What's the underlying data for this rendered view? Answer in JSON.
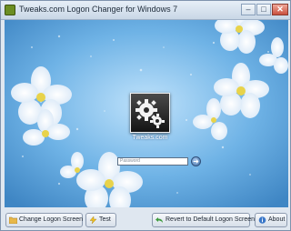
{
  "window": {
    "title": "Tweaks.com Logon Changer for Windows 7"
  },
  "login": {
    "username": "Tweaks.com",
    "password_placeholder": "Password"
  },
  "buttons": {
    "change": "Change Logon Screen",
    "test": "Test",
    "revert": "Revert to Default Logon Screen",
    "about": "About"
  },
  "icons": [
    "app-icon",
    "gear-icon",
    "folder-icon",
    "lightning-icon",
    "undo-icon",
    "info-icon",
    "arrow-right-icon"
  ],
  "colors": {
    "background_sky": "#6fb3e6",
    "flower_petal": "#f5f9ff",
    "flower_center": "#e8d34b"
  }
}
